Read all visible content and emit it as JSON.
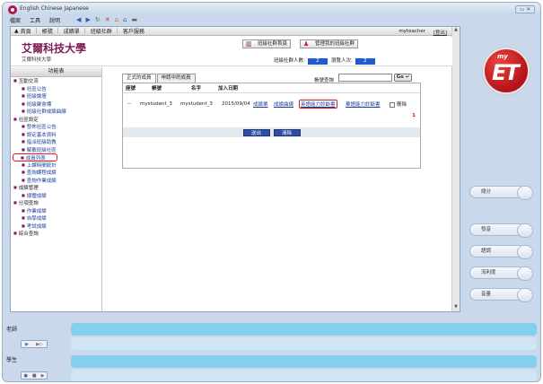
{
  "window": {
    "title": "English Chinese Japanese",
    "close_label": ""
  },
  "menu": {
    "items": [
      "檔案",
      "工具",
      "說明"
    ]
  },
  "topnav": {
    "items": [
      "首頁",
      "帳號",
      "成績單",
      "班級社群",
      "客戶服務"
    ],
    "user": "myteacher",
    "logout": "[登出]"
  },
  "header": {
    "school_name": "艾爾科技大學",
    "school_sub": "艾爾科技大學",
    "btn_community_home": "班級社群首頁",
    "btn_manage_community": "管理我的班級社群",
    "member_count_label": "班級社群人數:",
    "member_count": "2",
    "browse_count_label": "瀏覽人次:",
    "browse_count": "2"
  },
  "sidebar": {
    "title": "功能表",
    "items": [
      {
        "label": "互動交流",
        "type": "group"
      },
      {
        "label": "社區公告",
        "type": "sub"
      },
      {
        "label": "班級論壇",
        "type": "sub"
      },
      {
        "label": "班級聚會標",
        "type": "sub"
      },
      {
        "label": "班級社群成績曲線",
        "type": "sub"
      },
      {
        "label": "社區設定",
        "type": "group"
      },
      {
        "label": "發佈社區公告",
        "type": "sub"
      },
      {
        "label": "設定基本資料",
        "type": "sub"
      },
      {
        "label": "指派班級助教",
        "type": "sub"
      },
      {
        "label": "解散班級社區",
        "type": "sub"
      },
      {
        "label": "成員列表",
        "type": "sub",
        "active": true
      },
      {
        "label": "上課時間統計",
        "type": "sub"
      },
      {
        "label": "查詢課程成績",
        "type": "sub"
      },
      {
        "label": "查詢作業成績",
        "type": "sub"
      },
      {
        "label": "成績管理",
        "type": "group"
      },
      {
        "label": "總體成績",
        "type": "sub"
      },
      {
        "label": "分項查詢",
        "type": "group"
      },
      {
        "label": "作業成績",
        "type": "sub"
      },
      {
        "label": "自學成績",
        "type": "sub"
      },
      {
        "label": "考試成績",
        "type": "sub"
      },
      {
        "label": "綜合查詢",
        "type": "group"
      }
    ]
  },
  "main": {
    "tabs": [
      "正式的成員",
      "申請中的成員"
    ],
    "search_label": "帳號查詢",
    "search_value": "",
    "go_label": "Go",
    "columns": [
      "座號",
      "帳號",
      "名字",
      "加入日期"
    ],
    "rows": [
      {
        "seat": "--",
        "account": "mystudent_3",
        "name": "mystudent_3",
        "joined": "2015/09/04",
        "link1": "成績單",
        "link2": "成績曲線",
        "link3": "英語能力診斷書",
        "link4": "華語能力診斷書",
        "remove": "刪除"
      }
    ],
    "page_number": "1",
    "btn_submit": "送出",
    "btn_clear": "清除"
  },
  "rail": {
    "logo_my": "my",
    "logo_et": "ET",
    "buttons": [
      "總分",
      "發音",
      "語調",
      "流利度",
      "音量"
    ]
  },
  "panels": {
    "teacher": "老師",
    "student": "學生"
  }
}
